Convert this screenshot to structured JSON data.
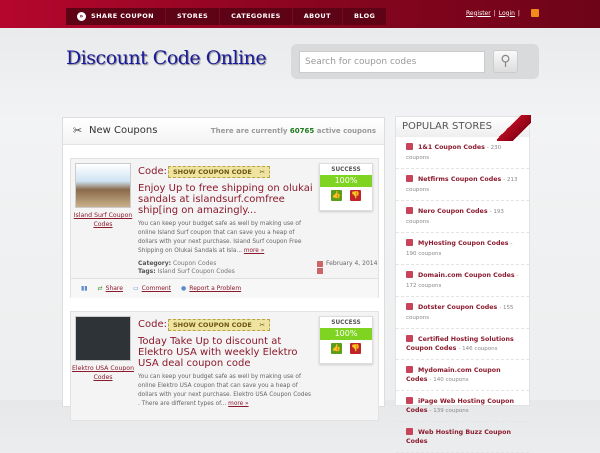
{
  "nav": {
    "items": [
      "SHARE COUPON",
      "STORES",
      "CATEGORIES",
      "ABOUT",
      "BLOG"
    ],
    "register": "Register",
    "login": "Login",
    "sep": "|"
  },
  "logo": "Discount Code Online",
  "search": {
    "placeholder": "Search for coupon codes"
  },
  "main": {
    "title": "New Coupons",
    "count_prefix": "There are currently",
    "count": "60765",
    "count_suffix": "active coupons"
  },
  "coupons": [
    {
      "store": "Island Surf Coupon Codes",
      "code_label": "Code:",
      "show": "SHOW COUPON CODE",
      "title": "Enjoy Up to free shipping on olukai sandals at islandsurf.comfree ship[ing on amazingly...",
      "desc": "You can keep your budget safe as well by making use of online Island Surf coupon that can save you a heap of dollars with your next purchase. Island Surf coupon Free Shipping on Olukai Sandals at Isla...",
      "more": "more »",
      "category_label": "Category:",
      "category": "Coupon Codes",
      "tags_label": "Tags:",
      "tags": "Island Surf Coupon Codes",
      "date": "February 4, 2014",
      "success": "SUCCESS",
      "rate": "100%",
      "share": "Share",
      "comment": "Comment",
      "report": "Report a Problem"
    },
    {
      "store": "Elektro USA Coupon Codes",
      "code_label": "Code:",
      "show": "SHOW COUPON CODE",
      "title": "Today Take Up to discount at Elektro USA with weekly Elektro USA deal coupon code",
      "desc": "You can keep your budget safe as well by making use of online Elektro USA coupon that can save you a heap of dollars with your next purchase. Elektro USA Coupon Codes . There are different types of...",
      "more": "more »",
      "success": "SUCCESS",
      "rate": "100%"
    }
  ],
  "sidebar": {
    "title": "POPULAR STORES",
    "stores": [
      {
        "name": "1&1 Coupon Codes",
        "count": "- 230 coupons"
      },
      {
        "name": "Netfirms Coupon Codes",
        "count": "- 213 coupons"
      },
      {
        "name": "Nero Coupon Codes",
        "count": "- 193 coupons"
      },
      {
        "name": "MyHosting Coupon Codes",
        "count": "- 190 coupons"
      },
      {
        "name": "Domain.com Coupon Codes",
        "count": "- 172 coupons"
      },
      {
        "name": "Dotster Coupon Codes",
        "count": "- 155 coupons"
      },
      {
        "name": "Certified Hosting Solutions Coupon Codes",
        "count": "- 146 coupons"
      },
      {
        "name": "Mydomain.com Coupon Codes",
        "count": "- 140 coupons"
      },
      {
        "name": "iPage Web Hosting Coupon Codes",
        "count": "- 139 coupons"
      },
      {
        "name": "Web Hosting Buzz Coupon Codes",
        "count": ""
      }
    ]
  },
  "colors": {
    "brand": "#8a0520",
    "accent_green": "#7fd321",
    "link": "#8b1a2c"
  }
}
